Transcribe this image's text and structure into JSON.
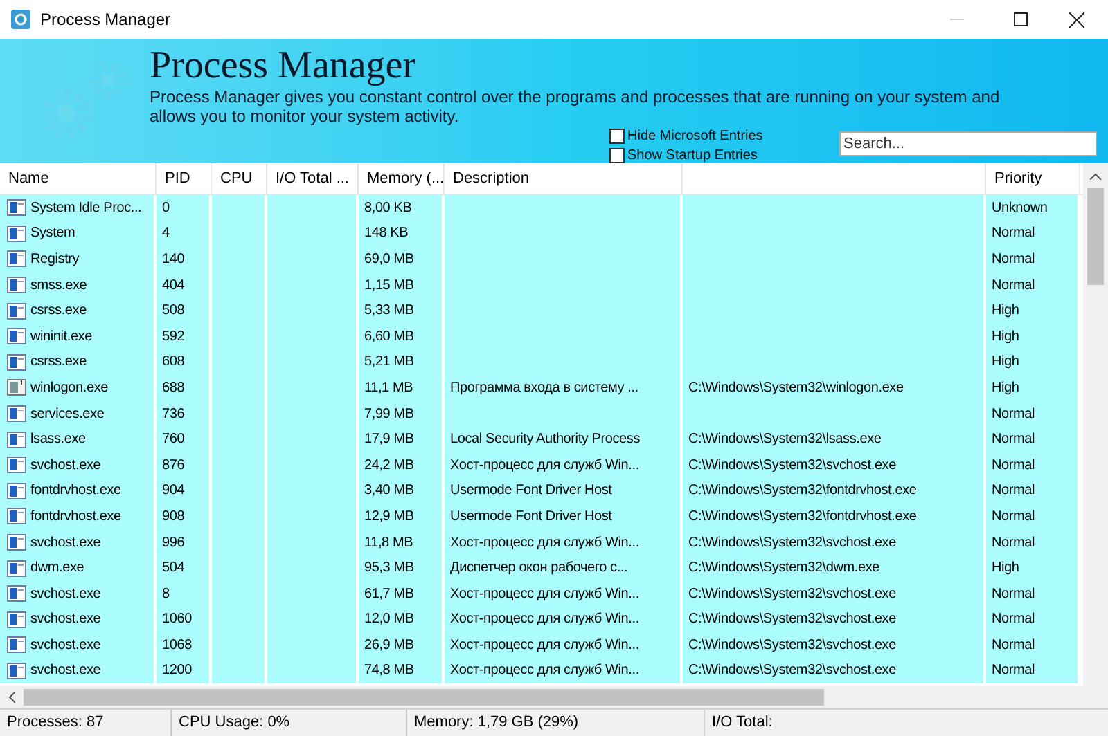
{
  "window": {
    "title": "Process Manager"
  },
  "banner": {
    "title": "Process Manager",
    "description": "Process Manager gives you constant control over the programs and processes that are running on your system and allows you to monitor your system activity."
  },
  "filters": [
    {
      "label": "Hide Microsoft Entries",
      "checked": false
    },
    {
      "label": "Show Startup Entries",
      "checked": false
    }
  ],
  "search": {
    "placeholder": "Search..."
  },
  "table": {
    "columns": [
      "Name",
      "PID",
      "CPU",
      "I/O Total ...",
      "Memory (...",
      "Description",
      "",
      "Priority"
    ],
    "rows": [
      {
        "kind": "window",
        "cells": [
          "System Idle Proc...",
          "0",
          "",
          "",
          "8,00 KB",
          "",
          "",
          "Unknown"
        ]
      },
      {
        "kind": "window",
        "cells": [
          "System",
          "4",
          "",
          "",
          "148 KB",
          "",
          "",
          "Normal"
        ]
      },
      {
        "kind": "window",
        "cells": [
          "Registry",
          "140",
          "",
          "",
          "69,0 MB",
          "",
          "",
          "Normal"
        ]
      },
      {
        "kind": "window",
        "cells": [
          "smss.exe",
          "404",
          "",
          "",
          "1,15 MB",
          "",
          "",
          "Normal"
        ]
      },
      {
        "kind": "window",
        "cells": [
          "csrss.exe",
          "508",
          "",
          "",
          "5,33 MB",
          "",
          "",
          "High"
        ]
      },
      {
        "kind": "window",
        "cells": [
          "wininit.exe",
          "592",
          "",
          "",
          "6,60 MB",
          "",
          "",
          "High"
        ]
      },
      {
        "kind": "window",
        "cells": [
          "csrss.exe",
          "608",
          "",
          "",
          "5,21 MB",
          "",
          "",
          "High"
        ]
      },
      {
        "kind": "logon",
        "cells": [
          "winlogon.exe",
          "688",
          "",
          "",
          "11,1 MB",
          "Программа входа в систему ...",
          "C:\\Windows\\System32\\winlogon.exe",
          "High"
        ]
      },
      {
        "kind": "window",
        "cells": [
          "services.exe",
          "736",
          "",
          "",
          "7,99 MB",
          "",
          "",
          "Normal"
        ]
      },
      {
        "kind": "window",
        "cells": [
          "lsass.exe",
          "760",
          "",
          "",
          "17,9 MB",
          "Local Security Authority Process",
          "C:\\Windows\\System32\\lsass.exe",
          "Normal"
        ]
      },
      {
        "kind": "window",
        "cells": [
          "svchost.exe",
          "876",
          "",
          "",
          "24,2 MB",
          "Хост-процесс для служб Win...",
          "C:\\Windows\\System32\\svchost.exe",
          "Normal"
        ]
      },
      {
        "kind": "window",
        "cells": [
          "fontdrvhost.exe",
          "904",
          "",
          "",
          "3,40 MB",
          "Usermode Font Driver Host",
          "C:\\Windows\\System32\\fontdrvhost.exe",
          "Normal"
        ]
      },
      {
        "kind": "window",
        "cells": [
          "fontdrvhost.exe",
          "908",
          "",
          "",
          "12,9 MB",
          "Usermode Font Driver Host",
          "C:\\Windows\\System32\\fontdrvhost.exe",
          "Normal"
        ]
      },
      {
        "kind": "window",
        "cells": [
          "svchost.exe",
          "996",
          "",
          "",
          "11,8 MB",
          "Хост-процесс для служб Win...",
          "C:\\Windows\\System32\\svchost.exe",
          "Normal"
        ]
      },
      {
        "kind": "window",
        "cells": [
          "dwm.exe",
          "504",
          "",
          "",
          "95,3 MB",
          "Диспетчер окон рабочего с...",
          "C:\\Windows\\System32\\dwm.exe",
          "High"
        ]
      },
      {
        "kind": "window",
        "cells": [
          "svchost.exe",
          "8",
          "",
          "",
          "61,7 MB",
          "Хост-процесс для служб Win...",
          "C:\\Windows\\System32\\svchost.exe",
          "Normal"
        ]
      },
      {
        "kind": "window",
        "cells": [
          "svchost.exe",
          "1060",
          "",
          "",
          "12,0 MB",
          "Хост-процесс для служб Win...",
          "C:\\Windows\\System32\\svchost.exe",
          "Normal"
        ]
      },
      {
        "kind": "window",
        "cells": [
          "svchost.exe",
          "1068",
          "",
          "",
          "26,9 MB",
          "Хост-процесс для служб Win...",
          "C:\\Windows\\System32\\svchost.exe",
          "Normal"
        ]
      },
      {
        "kind": "window",
        "cells": [
          "svchost.exe",
          "1200",
          "",
          "",
          "74,8 MB",
          "Хост-процесс для служб Win...",
          "C:\\Windows\\System32\\svchost.exe",
          "Normal"
        ]
      }
    ]
  },
  "status_bar": [
    "Processes: 87",
    "CPU Usage: 0%",
    "Memory: 1,79 GB (29%)",
    "I/O Total:"
  ]
}
